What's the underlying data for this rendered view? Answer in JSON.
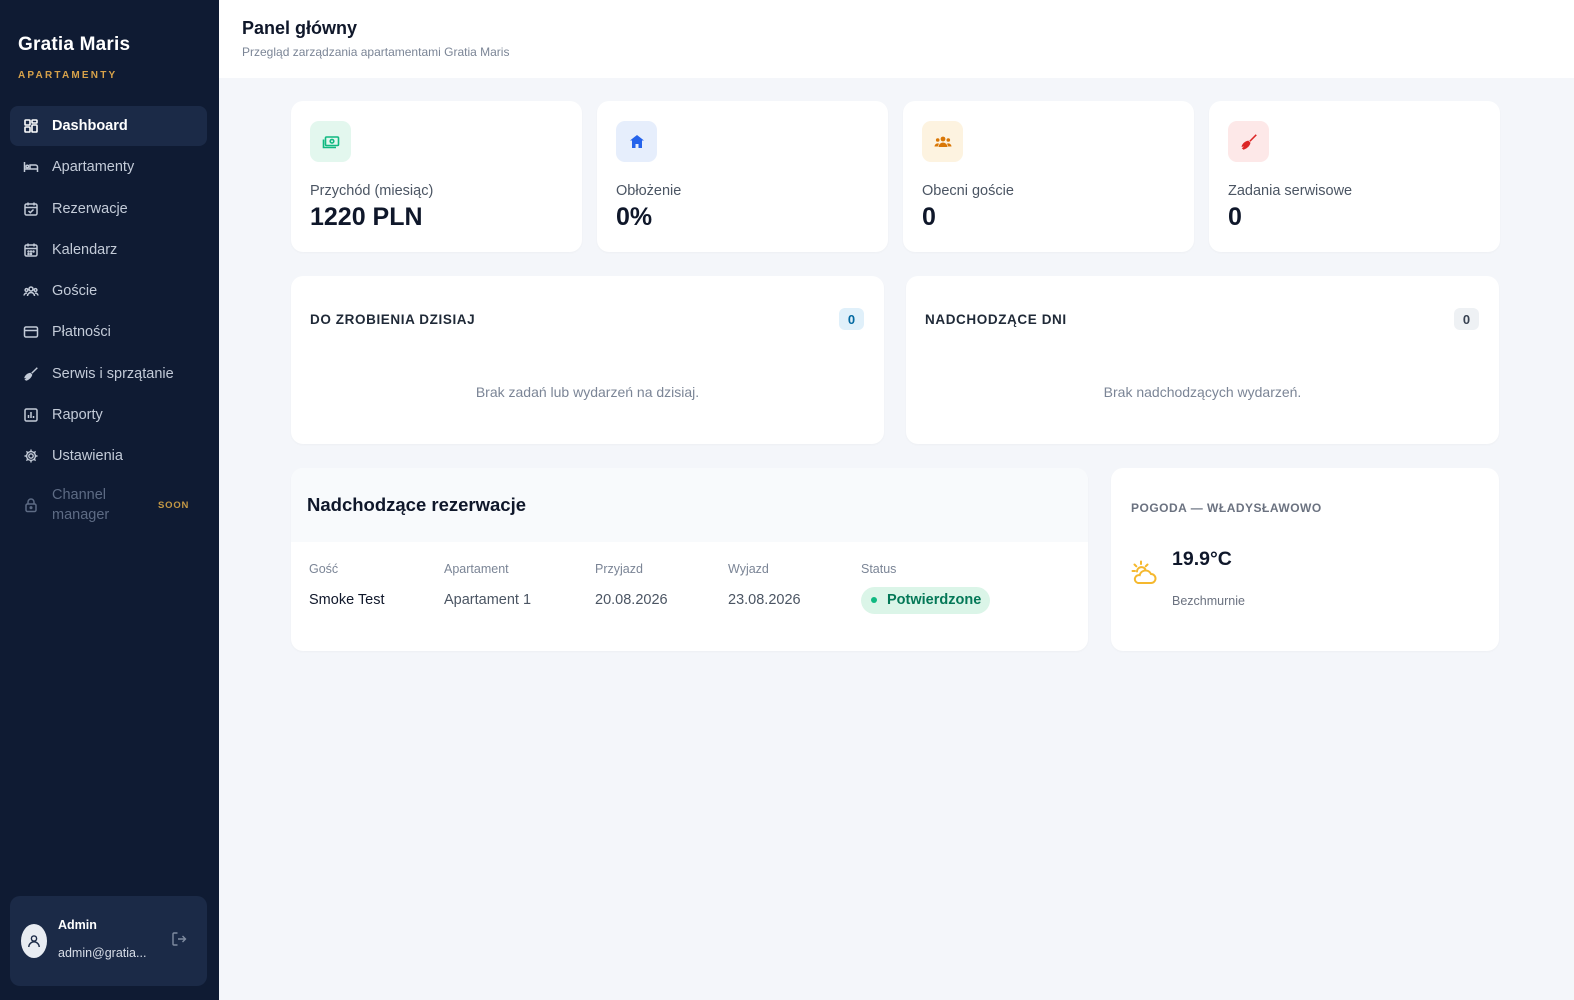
{
  "brand": {
    "name": "Gratia Maris",
    "subtitle": "APARTAMENTY"
  },
  "sidebar": {
    "items": [
      {
        "label": "Dashboard",
        "icon": "dashboard-grid-icon",
        "active": true
      },
      {
        "label": "Apartamenty",
        "icon": "bed-icon"
      },
      {
        "label": "Rezerwacje",
        "icon": "calendar-check-icon"
      },
      {
        "label": "Kalendarz",
        "icon": "calendar-icon"
      },
      {
        "label": "Goście",
        "icon": "users-icon"
      },
      {
        "label": "Płatności",
        "icon": "credit-card-icon"
      },
      {
        "label": "Serwis i sprzątanie",
        "icon": "broom-icon"
      },
      {
        "label": "Raporty",
        "icon": "bar-chart-icon"
      },
      {
        "label": "Ustawienia",
        "icon": "gear-icon"
      }
    ],
    "channel_manager": {
      "label": "Channel manager",
      "badge": "SOON",
      "icon": "lock-icon"
    }
  },
  "user": {
    "name": "Admin",
    "email": "admin@gratia...",
    "logout_icon": "logout-icon"
  },
  "header": {
    "title": "Panel główny",
    "subtitle": "Przegląd zarządzania apartamentami Gratia Maris"
  },
  "stats": [
    {
      "label": "Przychód (miesiąc)",
      "value": "1220 PLN",
      "icon": "money-icon",
      "color": "#10b981",
      "bg": "#e3f7ee"
    },
    {
      "label": "Obłożenie",
      "value": "0%",
      "icon": "home-icon",
      "color": "#2563eb",
      "bg": "#e6eefc"
    },
    {
      "label": "Obecni goście",
      "value": "0",
      "icon": "users-icon",
      "color": "#d97706",
      "bg": "#fdf3e0"
    },
    {
      "label": "Zadania serwisowe",
      "value": "0",
      "icon": "broom-icon",
      "color": "#dc2626",
      "bg": "#fde8e8"
    }
  ],
  "today": {
    "title": "DO ZROBIENIA DZISIAJ",
    "count": "0",
    "empty": "Brak zadań lub wydarzeń na dzisiaj.",
    "count_color": "#0369a1",
    "count_bg": "#e0f0fa"
  },
  "upcoming": {
    "title": "NADCHODZĄCE DNI",
    "count": "0",
    "empty": "Brak nadchodzących wydarzeń.",
    "count_color": "#374151",
    "count_bg": "#eef1f4"
  },
  "reservations": {
    "title": "Nadchodzące rezerwacje",
    "columns": [
      "Gość",
      "Apartament",
      "Przyjazd",
      "Wyjazd",
      "Status"
    ],
    "rows": [
      {
        "guest": "Smoke Test",
        "apartment": "Apartament 1",
        "arrival": "20.08.2026",
        "departure": "23.08.2026",
        "status": "Potwierdzone"
      }
    ]
  },
  "weather": {
    "title": "POGODA — WŁADYSŁAWOWO",
    "temp": "19.9°C",
    "desc": "Bezchmurnie",
    "icon": "sun-cloud-icon",
    "color": "#f5b82e"
  }
}
